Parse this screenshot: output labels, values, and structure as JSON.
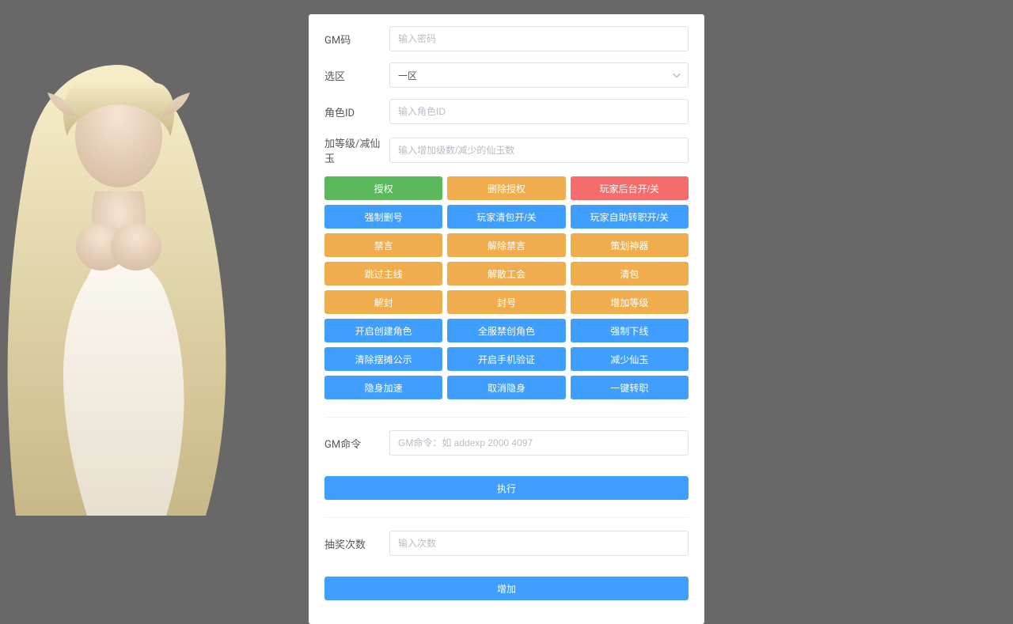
{
  "form": {
    "gm_code": {
      "label": "GM码",
      "placeholder": "输入密码"
    },
    "zone": {
      "label": "选区",
      "value": "一区"
    },
    "role_id": {
      "label": "角色ID",
      "placeholder": "输入角色ID"
    },
    "level": {
      "label": "加等级/减仙玉",
      "placeholder": "输入增加级数/减少的仙玉数"
    }
  },
  "button_rows": [
    [
      {
        "label": "授权",
        "color": "green"
      },
      {
        "label": "删除授权",
        "color": "orange"
      },
      {
        "label": "玩家后台开/关",
        "color": "red"
      }
    ],
    [
      {
        "label": "强制删号",
        "color": "blue"
      },
      {
        "label": "玩家清包开/关",
        "color": "blue"
      },
      {
        "label": "玩家自助转职开/关",
        "color": "blue"
      }
    ],
    [
      {
        "label": "禁言",
        "color": "orange"
      },
      {
        "label": "解除禁言",
        "color": "orange"
      },
      {
        "label": "策划神器",
        "color": "orange"
      }
    ],
    [
      {
        "label": "跳过主线",
        "color": "orange"
      },
      {
        "label": "解散工会",
        "color": "orange"
      },
      {
        "label": "清包",
        "color": "orange"
      }
    ],
    [
      {
        "label": "解封",
        "color": "orange"
      },
      {
        "label": "封号",
        "color": "orange"
      },
      {
        "label": "增加等级",
        "color": "orange"
      }
    ],
    [
      {
        "label": "开启创建角色",
        "color": "blue"
      },
      {
        "label": "全服禁创角色",
        "color": "blue"
      },
      {
        "label": "强制下线",
        "color": "blue"
      }
    ],
    [
      {
        "label": "清除摆摊公示",
        "color": "blue"
      },
      {
        "label": "开启手机验证",
        "color": "blue"
      },
      {
        "label": "减少仙玉",
        "color": "blue"
      }
    ],
    [
      {
        "label": "隐身加速",
        "color": "blue"
      },
      {
        "label": "取消隐身",
        "color": "blue"
      },
      {
        "label": "一键转职",
        "color": "blue"
      }
    ]
  ],
  "gm_cmd": {
    "label": "GM命令",
    "placeholder": "GM命令：如 addexp 2000 4097",
    "submit": "执行"
  },
  "lottery": {
    "label": "抽奖次数",
    "placeholder": "输入次数",
    "submit": "增加"
  }
}
